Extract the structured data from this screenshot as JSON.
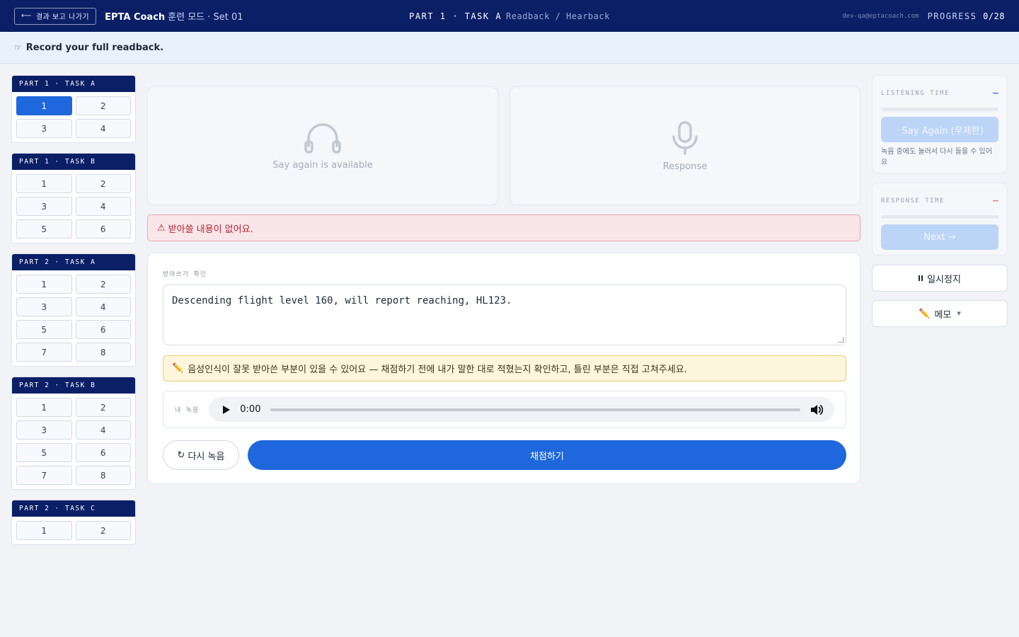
{
  "topbar": {
    "exit_label": "결과 보고 나가기",
    "brand": "EPTA Coach",
    "mode": "훈련 모드 · Set 01",
    "part_task": "PART 1 · TASK A",
    "task_type": "Readback / Hearback",
    "email": "dev-qa@eptacoach.com",
    "progress_label": "PROGRESS",
    "progress_value": "0/28"
  },
  "instruction": {
    "icon": "pointing-hand-icon",
    "text": "Record your full readback."
  },
  "sidebar": {
    "groups": [
      {
        "title": "PART 1 · TASK A",
        "items": [
          "1",
          "2",
          "3",
          "4"
        ],
        "active": "1"
      },
      {
        "title": "PART 1 · TASK B",
        "items": [
          "1",
          "2",
          "3",
          "4",
          "5",
          "6"
        ]
      },
      {
        "title": "PART 2 · TASK A",
        "items": [
          "1",
          "2",
          "3",
          "4",
          "5",
          "6",
          "7",
          "8"
        ]
      },
      {
        "title": "PART 2 · TASK B",
        "items": [
          "1",
          "2",
          "3",
          "4",
          "5",
          "6",
          "7",
          "8"
        ]
      },
      {
        "title": "PART 2 · TASK C",
        "items": [
          "1",
          "2"
        ]
      }
    ]
  },
  "media": {
    "listen_caption": "Say again is available",
    "response_caption": "Response"
  },
  "alert": {
    "icon": "warning-icon",
    "text": "받아쓸 내용이 없어요."
  },
  "panel": {
    "label": "받아쓰기 확인",
    "transcript": "Descending flight level 160, will report reaching, HL123.",
    "hint": "음성인식이 잘못 받아쓴 부분이 있을 수 있어요 — 채점하기 전에 내가 말한 대로 적혔는지 확인하고, 틀린 부분은 직접 고쳐주세요.",
    "recording_label": "내 녹음",
    "audio_time": "0:00",
    "retry_label": "다시 녹음",
    "grade_label": "채점하기"
  },
  "right": {
    "listening_title": "LISTENING TIME",
    "say_again_label": "· Say Again (무제한)",
    "listening_note": "녹음 중에도 눌러서 다시 들을 수 있어요",
    "response_title": "RESPONSE TIME",
    "next_label": "Next →",
    "pause_label": "일시정지",
    "memo_label": "메모"
  },
  "colors": {
    "navy": "#0a1f66",
    "primary": "#1e67dc",
    "alert_red": "#b42335",
    "hint_yellow": "#fdf6dc"
  }
}
